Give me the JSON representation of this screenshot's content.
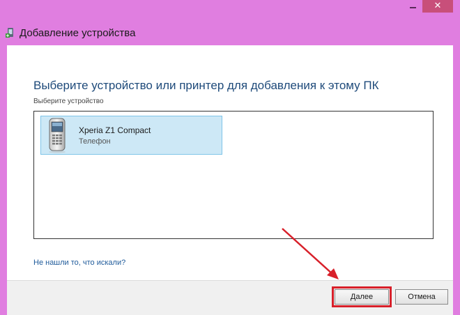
{
  "window": {
    "title": "Добавление устройства",
    "icons": {
      "close": "close-icon",
      "minimize": "minimize-icon",
      "title": "device-add-icon"
    }
  },
  "content": {
    "heading": "Выберите устройство или принтер для добавления к этому ПК",
    "subheading": "Выберите устройство",
    "devices": [
      {
        "name": "Xperia Z1 Compact",
        "type": "Телефон",
        "icon": "phone-icon",
        "selected": true
      }
    ],
    "help_link": "Не нашли то, что искали?"
  },
  "buttons": {
    "next_label": "Далее",
    "cancel_label": "Отмена"
  },
  "colors": {
    "frame": "#e07ee0",
    "heading": "#1e4a7a",
    "selection": "#cde8f6",
    "highlight": "#d8202a"
  }
}
